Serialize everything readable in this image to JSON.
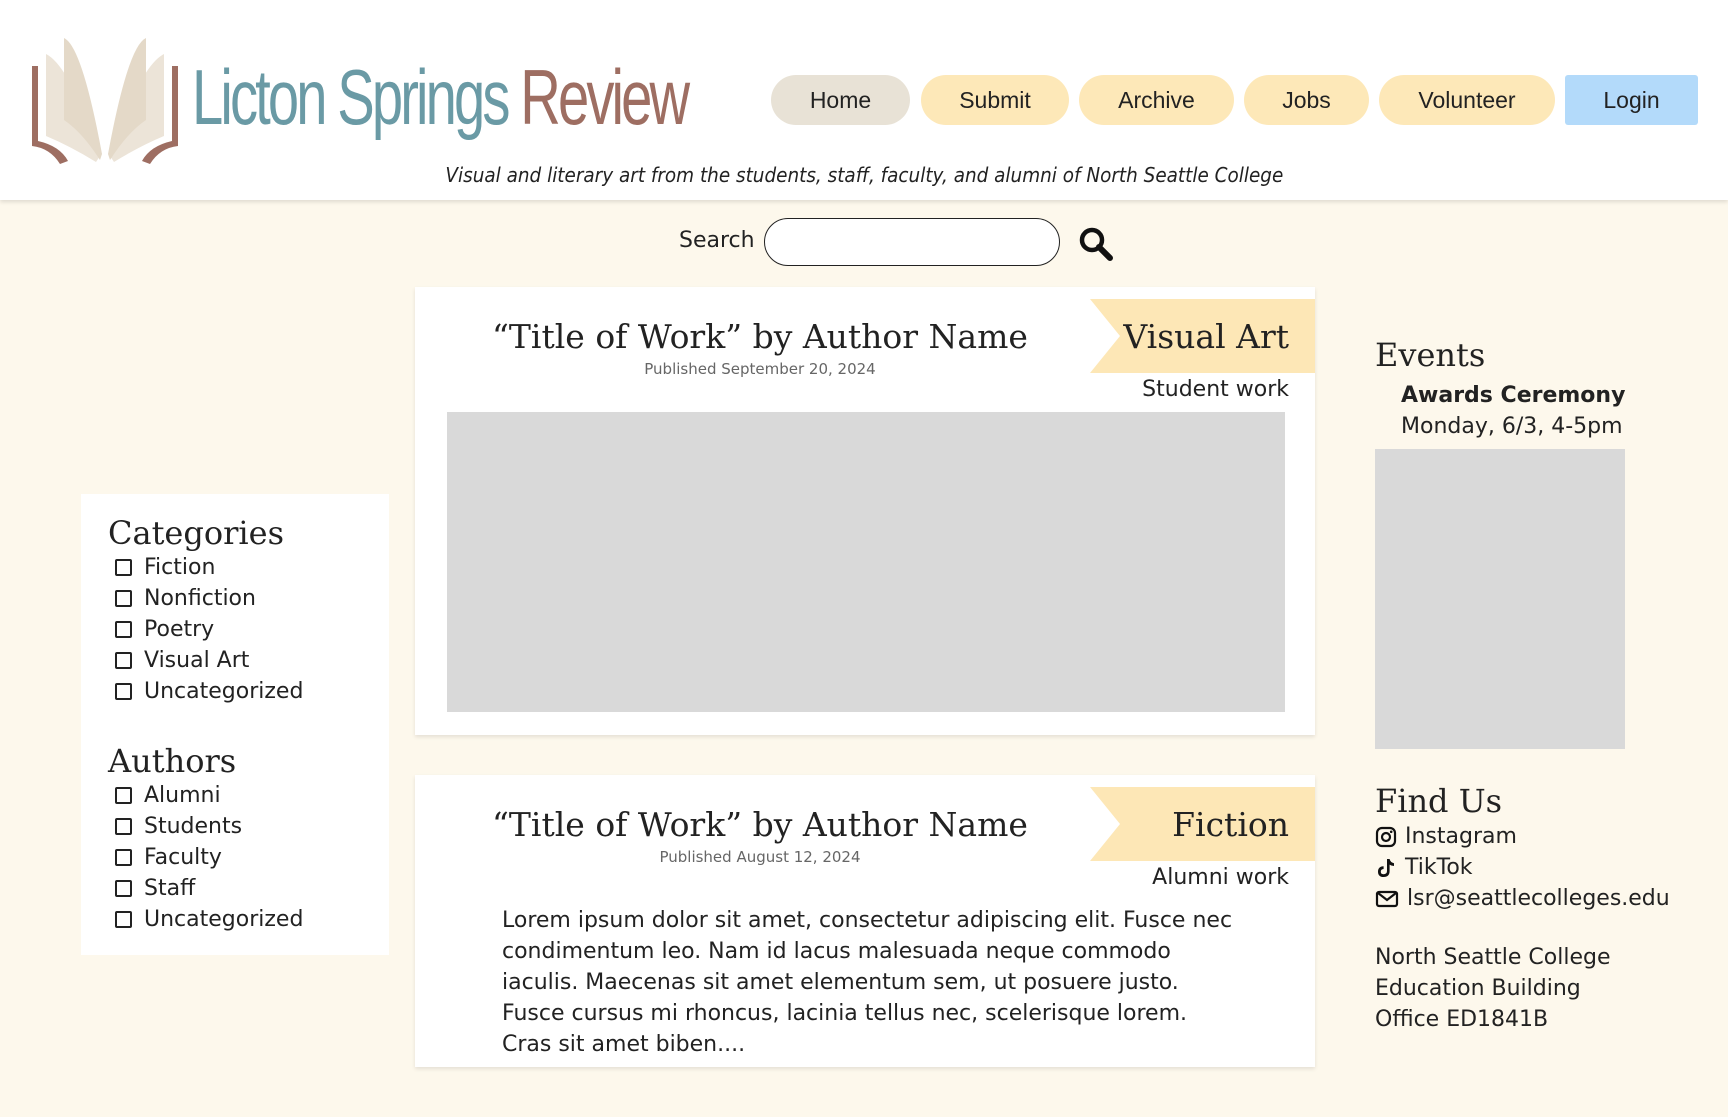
{
  "site": {
    "logo_part1": "Licton Springs",
    "logo_part2": "Review",
    "tagline": "Visual and literary art from the students, staff, faculty, and alumni of North Seattle College"
  },
  "nav": {
    "home": "Home",
    "submit": "Submit",
    "archive": "Archive",
    "jobs": "Jobs",
    "volunteer": "Volunteer",
    "login": "Login"
  },
  "search": {
    "label": "Search",
    "placeholder": ""
  },
  "posts": [
    {
      "title": "“Title of Work” by Author Name",
      "date": "Published September 20, 2024",
      "category": "Visual Art",
      "work_type": "Student work"
    },
    {
      "title": "“Title of Work” by Author Name",
      "date": "Published August 12, 2024",
      "category": "Fiction",
      "work_type": "Alumni work",
      "excerpt": "Lorem ipsum dolor sit amet, consectetur adipiscing elit. Fusce nec condimentum leo. Nam id lacus malesuada neque commodo iaculis. Maecenas sit amet elementum sem, ut posuere justo. Fusce cursus mi rhoncus, lacinia tellus nec, scelerisque lorem. Cras sit amet biben...."
    }
  ],
  "sidebar": {
    "categories_heading": "Categories",
    "categories": [
      "Fiction",
      "Nonfiction",
      "Poetry",
      "Visual Art",
      "Uncategorized"
    ],
    "authors_heading": "Authors",
    "authors": [
      "Alumni",
      "Students",
      "Faculty",
      "Staff",
      "Uncategorized"
    ]
  },
  "events": {
    "heading": "Events",
    "name": "Awards Ceremony",
    "date": "Monday, 6/3, 4-5pm"
  },
  "find_us": {
    "heading": "Find Us",
    "instagram": "Instagram",
    "tiktok": "TikTok",
    "email": "lsr@seattlecolleges.edu",
    "address_line1": "North Seattle College",
    "address_line2": "Education Building",
    "address_line3": "Office ED1841B"
  },
  "colors": {
    "page_bg": "#fdf8ec",
    "nav_pill": "#fde8b8",
    "nav_home": "#e8e2d6",
    "login_bg": "#b3dafa",
    "logo_teal": "#6a9aa5",
    "logo_brown": "#9e6e62",
    "placeholder_gray": "#d9d9d9"
  }
}
